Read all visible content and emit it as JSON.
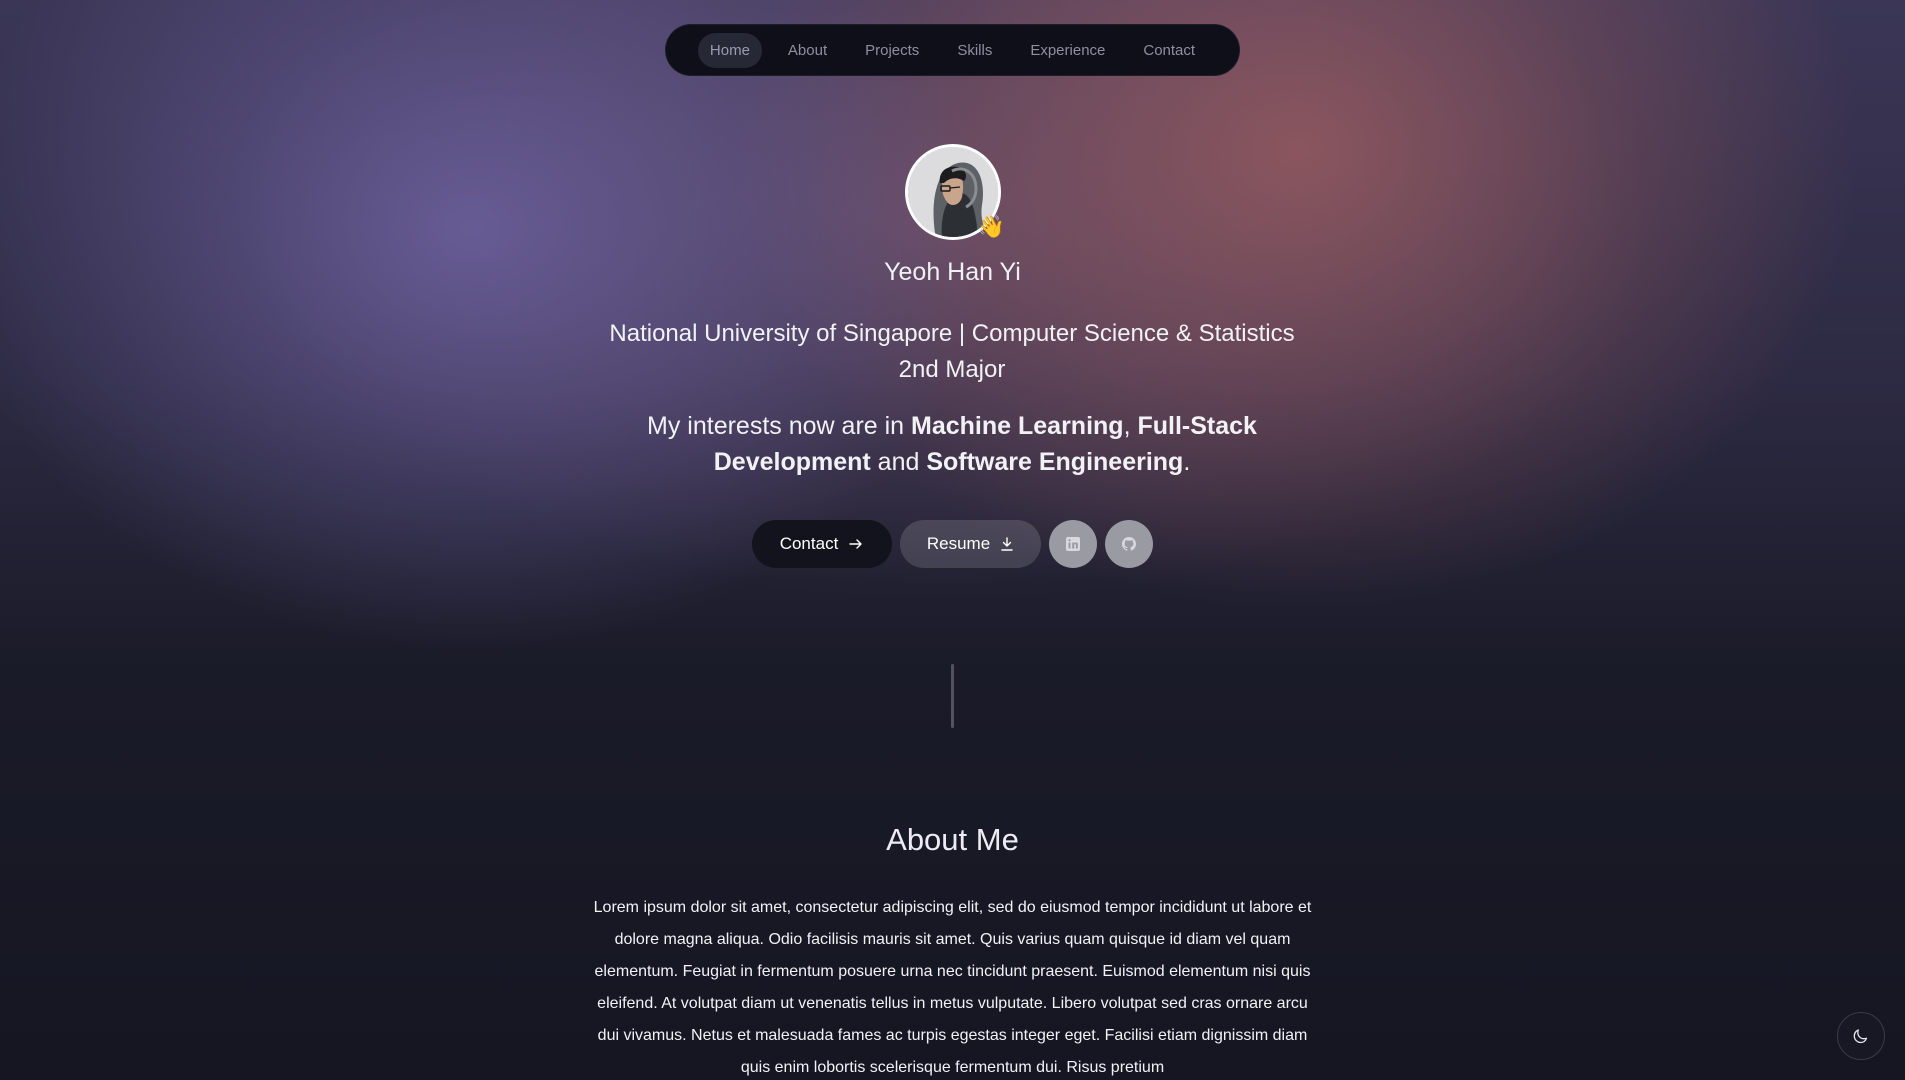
{
  "nav": {
    "items": [
      {
        "label": "Home",
        "active": true
      },
      {
        "label": "About"
      },
      {
        "label": "Projects"
      },
      {
        "label": "Skills"
      },
      {
        "label": "Experience"
      },
      {
        "label": "Contact"
      }
    ]
  },
  "hero": {
    "avatar_icon": "person-hoodie-avatar",
    "wave_emoji": "👋",
    "name": "Yeoh Han Yi",
    "subtitle_line1": "National University of Singapore | Computer Science & Statistics",
    "subtitle_line2": "2nd Major",
    "interests_prefix": "My interests now are in ",
    "interest_1": "Machine Learning",
    "sep_1": ", ",
    "interest_2": "Full-Stack Development",
    "sep_2": " and ",
    "interest_3": "Software Engineering",
    "interests_suffix": "."
  },
  "actions": {
    "contact_label": "Contact",
    "contact_icon": "arrow-right-icon",
    "resume_label": "Resume",
    "resume_icon": "download-icon",
    "linkedin_icon": "linkedin-icon",
    "github_icon": "github-icon"
  },
  "about": {
    "title": "About Me",
    "text": "Lorem ipsum dolor sit amet, consectetur adipiscing elit, sed do eiusmod tempor incididunt ut labore et dolore magna aliqua. Odio facilisis mauris sit amet. Quis varius quam quisque id diam vel quam elementum. Feugiat in fermentum posuere urna nec tincidunt praesent. Euismod elementum nisi quis eleifend. At volutpat diam ut venenatis tellus in metus vulputate. Libero volutpat sed cras ornare arcu dui vivamus. Netus et malesuada fames ac turpis egestas integer eget. Facilisi etiam dignissim diam quis enim lobortis scelerisque fermentum dui. Risus pretium"
  },
  "theme_toggle": {
    "icon": "moon-icon"
  },
  "colors": {
    "nav_bg": "#0e0f18",
    "contact_btn_bg": "#12131c",
    "social_btn_bg": "#9a9aa3",
    "page_bg": "#151622"
  }
}
